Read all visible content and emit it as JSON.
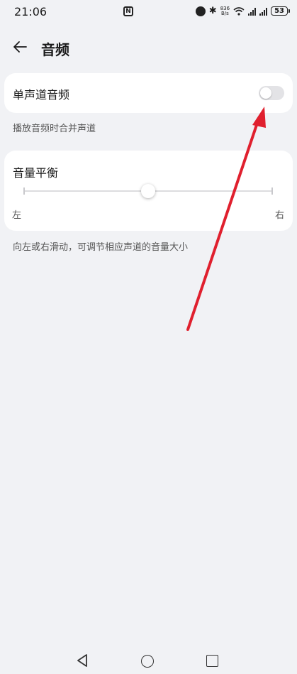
{
  "status_bar": {
    "time": "21:06",
    "nfc_label": "N",
    "net_speed_value": "836",
    "net_speed_unit": "B/s",
    "battery": "53"
  },
  "header": {
    "title": "音频"
  },
  "mono_audio": {
    "label": "单声道音频",
    "enabled": false,
    "helper": "播放音频时合并声道"
  },
  "balance": {
    "label": "音量平衡",
    "left_label": "左",
    "right_label": "右",
    "value": 0.5,
    "helper": "向左或右滑动，可调节相应声道的音量大小"
  },
  "annotation": {
    "color": "#e0202e"
  },
  "icons": {
    "back": "arrow-left-icon",
    "nav_back": "triangle-back-icon",
    "nav_home": "circle-home-icon",
    "nav_recent": "square-recent-icon"
  }
}
